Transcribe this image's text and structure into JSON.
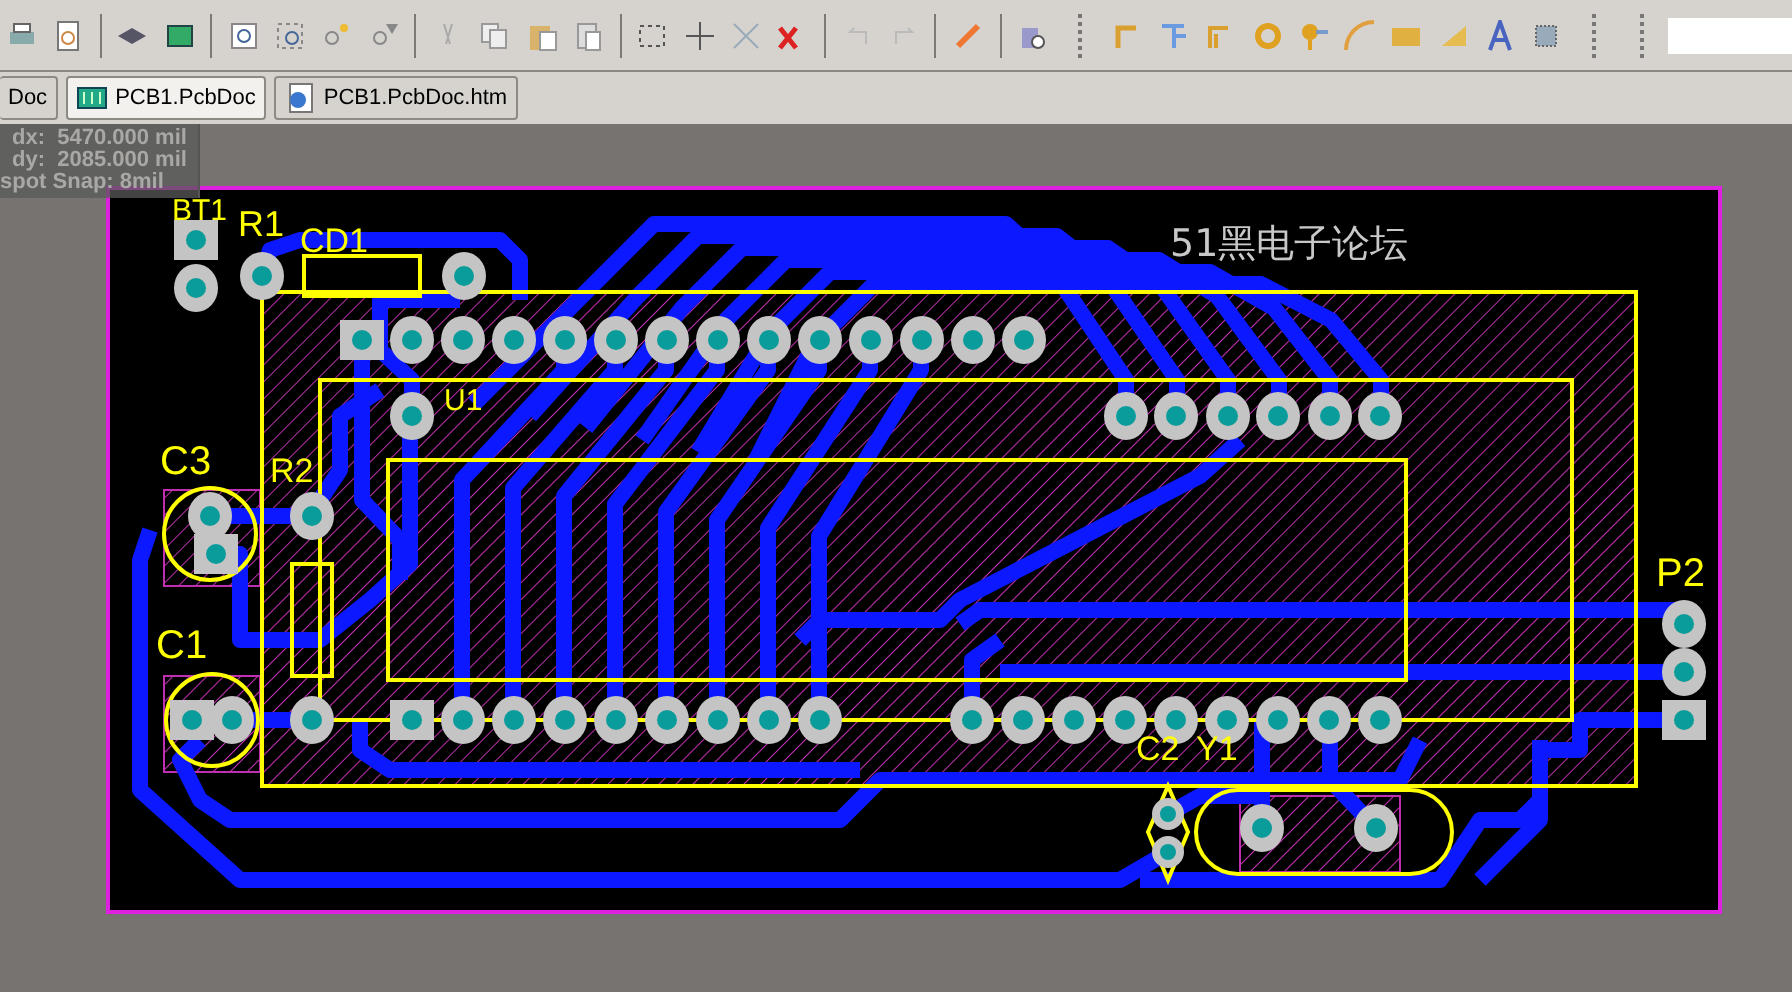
{
  "tabs": [
    {
      "label": "Doc",
      "selected": false
    },
    {
      "label": "PCB1.PcbDoc",
      "selected": true,
      "kind": "pcb"
    },
    {
      "label": "PCB1.PcbDoc.htm",
      "selected": false,
      "kind": "web"
    }
  ],
  "hud": {
    "lines": [
      "dx:  5470.000 mil",
      "dy:  2085.000 mil",
      "spot Snap: 8mil"
    ]
  },
  "board": {
    "title": "51黑电子论坛",
    "designators": [
      {
        "text": "BT1"
      },
      {
        "text": "R1"
      },
      {
        "text": "CD1"
      },
      {
        "text": "U1"
      },
      {
        "text": "C3"
      },
      {
        "text": "R2"
      },
      {
        "text": "C1"
      },
      {
        "text": "C2"
      },
      {
        "text": "Y1"
      },
      {
        "text": "P2"
      }
    ]
  }
}
